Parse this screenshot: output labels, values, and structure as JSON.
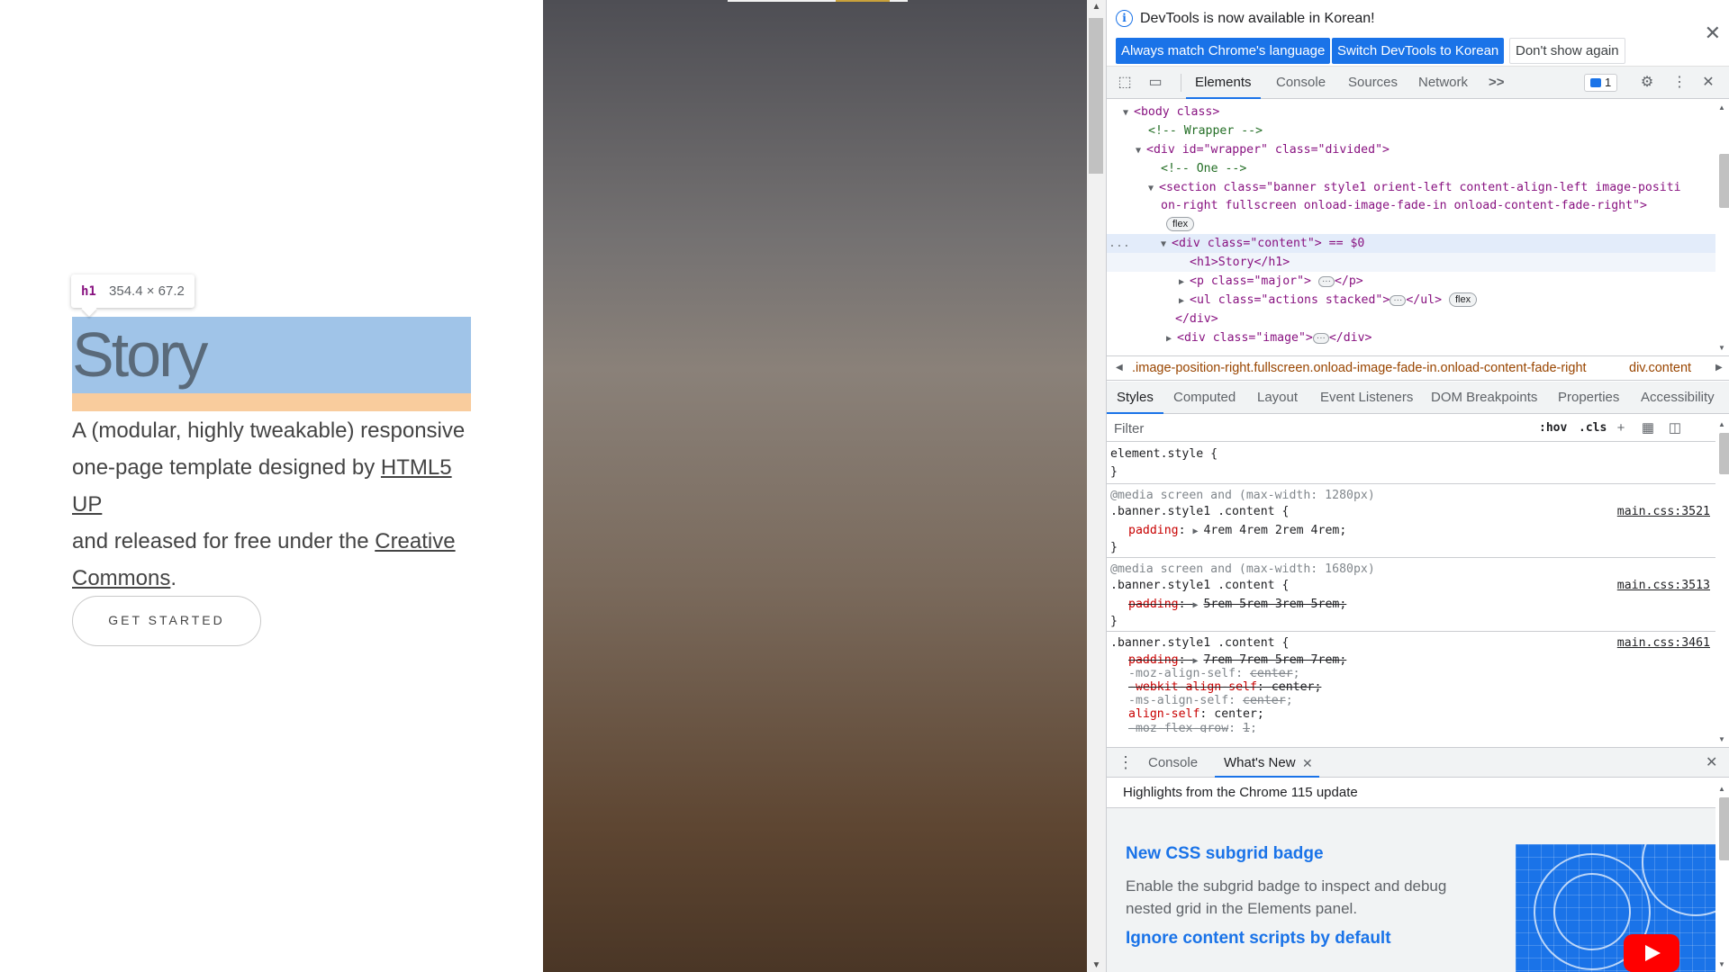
{
  "page": {
    "tooltip": {
      "tag": "h1",
      "dimensions": "354.4 × 67.2"
    },
    "heading": "Story",
    "major": {
      "text_1": "A (modular, highly tweakable) responsive",
      "text_2": "one-page template designed by ",
      "link_1": "HTML5 UP",
      "text_3": "and released for free under the ",
      "link_2a": "Creative",
      "link_2b": "Commons",
      "text_4": "."
    },
    "button": "GET STARTED"
  },
  "devtools": {
    "infobar": {
      "message": "DevTools is now available in Korean!",
      "btn_match": "Always match Chrome's language",
      "btn_switch": "Switch DevTools to Korean",
      "btn_dismiss": "Don't show again"
    },
    "tabs": [
      "Elements",
      "Console",
      "Sources",
      "Network"
    ],
    "more_tabs": ">>",
    "issues_count": "1",
    "dom": {
      "body_open": "<body class>",
      "comment_wrapper": "<!-- Wrapper -->",
      "div_wrapper": "<div id=\"wrapper\" class=\"divided\">",
      "comment_one": "<!-- One -->",
      "section_line1": "<section class=\"banner style1 orient-left content-align-left image-positi",
      "section_line2": "on-right fullscreen onload-image-fade-in onload-content-fade-right\">",
      "flex_pill": "flex",
      "div_content": "<div class=\"content\"> == $0",
      "h1": "<h1>Story</h1>",
      "p_major": "<p class=\"major\">",
      "p_close": "</p>",
      "ul": "<ul class=\"actions stacked\">",
      "ul_close": "</ul>",
      "div_close": "</div>",
      "div_image": "<div class=\"image\">",
      "div_image_close": "</div>",
      "gutter_dots": "..."
    },
    "breadcrumbs": {
      "left": ".image-position-right.fullscreen.onload-image-fade-in.onload-content-fade-right",
      "right": "div.content"
    },
    "style_tabs": [
      "Styles",
      "Computed",
      "Layout",
      "Event Listeners",
      "DOM Breakpoints",
      "Properties",
      "Accessibility"
    ],
    "filter_placeholder": "Filter",
    "hov": ":hov",
    "cls": ".cls",
    "styles": {
      "element_style": "element.style {",
      "close_brace": "}",
      "media_1280": "@media screen and (max-width: 1280px)",
      "sel_1": ".banner.style1 .content {",
      "src_1": "main.css:3521",
      "pad_1_prop": "padding",
      "pad_1_val": "4rem 4rem 2rem 4rem;",
      "media_1680": "@media screen and (max-width: 1680px)",
      "sel_2": ".banner.style1 .content {",
      "src_2": "main.css:3513",
      "pad_2_prop": "padding",
      "pad_2_val": "5rem 5rem 3rem 5rem;",
      "sel_3": ".banner.style1 .content {",
      "src_3": "main.css:3461",
      "pad_3_prop": "padding",
      "pad_3_val": "7rem 7rem 5rem 7rem;",
      "moz_prop": "-moz-align-self",
      "moz_val": "center",
      "webkit_prop": "-webkit-align-self",
      "webkit_val": "center;",
      "ms_prop": "-ms-align-self",
      "ms_val": "center",
      "align_prop": "align-self",
      "align_val": "center;",
      "flexgrow_prop": "-moz-flex-grow",
      "flexgrow_val": "1"
    },
    "drawer": {
      "tabs": [
        "Console",
        "What's New"
      ],
      "headline": "Highlights from the Chrome 115 update",
      "item_1_title": "New CSS subgrid badge",
      "item_1_desc": "Enable the subgrid badge to inspect and debug nested grid in the Elements panel.",
      "item_2_title": "Ignore content scripts by default"
    }
  },
  "colors": {
    "accent": "#1a73e8",
    "h1_highlight": "#a0c4e8",
    "margin_highlight": "#f9cc9d"
  }
}
